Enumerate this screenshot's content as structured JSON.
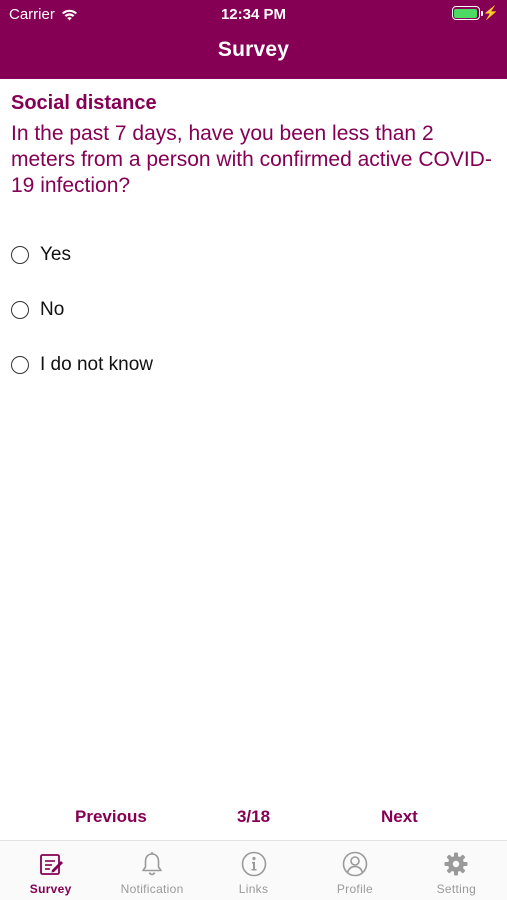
{
  "status_bar": {
    "carrier": "Carrier",
    "time": "12:34 PM",
    "battery_color": "#4cd964"
  },
  "header": {
    "title": "Survey",
    "background": "#850054"
  },
  "survey": {
    "section": "Social distance",
    "question": "In the past 7 days, have you been less than 2 meters from a person with confirmed active COVID-19 infection?",
    "options": [
      {
        "label": "Yes",
        "selected": false
      },
      {
        "label": "No",
        "selected": false
      },
      {
        "label": "I do not know",
        "selected": false
      }
    ]
  },
  "pager": {
    "previous": "Previous",
    "count": "3/18",
    "next": "Next"
  },
  "tabbar": {
    "items": [
      {
        "label": "Survey",
        "icon": "survey-icon",
        "active": true
      },
      {
        "label": "Notification",
        "icon": "bell-icon",
        "active": false
      },
      {
        "label": "Links",
        "icon": "info-icon",
        "active": false
      },
      {
        "label": "Profile",
        "icon": "user-icon",
        "active": false
      },
      {
        "label": "Setting",
        "icon": "gear-icon",
        "active": false
      }
    ]
  },
  "colors": {
    "accent": "#850054",
    "inactive_tab": "#9a9a9a"
  }
}
